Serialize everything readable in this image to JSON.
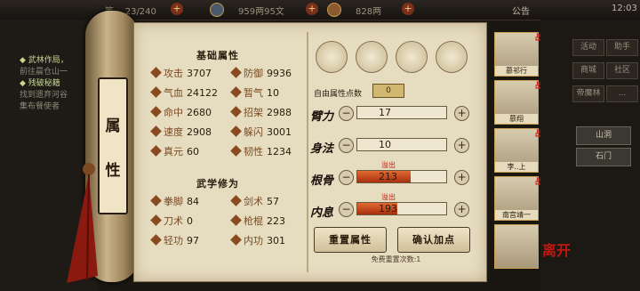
{
  "topbar": {
    "left_value": "等... 23/240",
    "silver": "959两95文",
    "gold": "828两",
    "notice": "公告",
    "time": "12:03"
  },
  "quests": [
    {
      "text": "◆ 武林作局，",
      "color": "#c8d890"
    },
    {
      "text": "前往晨仓山一",
      "color": "#8a8a78"
    },
    {
      "text": "◆ 残破秘籍",
      "color": "#c8d890"
    },
    {
      "text": "找到遗弃河谷",
      "color": "#8a8a78"
    },
    {
      "text": "集布餐使者",
      "color": "#8a8a78"
    }
  ],
  "scroll_label": [
    "属",
    "性"
  ],
  "base_title": "基础属性",
  "base_stats": [
    [
      {
        "label": "攻击",
        "value": "3707"
      },
      {
        "label": "防御",
        "value": "9936"
      }
    ],
    [
      {
        "label": "气血",
        "value": "24122"
      },
      {
        "label": "暂气",
        "value": "10"
      }
    ],
    [
      {
        "label": "命中",
        "value": "2680"
      },
      {
        "label": "招架",
        "value": "2988"
      }
    ],
    [
      {
        "label": "速度",
        "value": "2908"
      },
      {
        "label": "躲闪",
        "value": "3001"
      }
    ],
    [
      {
        "label": "真元",
        "value": "60"
      },
      {
        "label": "韧性",
        "value": "1234"
      }
    ]
  ],
  "martial_title": "武学修为",
  "martial_stats": [
    [
      {
        "label": "拳脚",
        "value": "84"
      },
      {
        "label": "剑术",
        "value": "57"
      }
    ],
    [
      {
        "label": "刀术",
        "value": "0"
      },
      {
        "label": "枪棍",
        "value": "223"
      }
    ],
    [
      {
        "label": "轻功",
        "value": "97"
      },
      {
        "label": "内功",
        "value": "301"
      }
    ]
  ],
  "free_points_label": "自由属性点数",
  "free_points_value": "0",
  "attributes": [
    {
      "char": "臂力",
      "value": "17",
      "overflow": "",
      "fill": 0.0
    },
    {
      "char": "身法",
      "value": "10",
      "overflow": "",
      "fill": 0.0
    },
    {
      "char": "根骨",
      "value": "213",
      "overflow": "溢出",
      "fill": 0.6
    },
    {
      "char": "内息",
      "value": "193",
      "overflow": "溢出",
      "fill": 0.45
    }
  ],
  "reset_button": "重置属性",
  "confirm_button": "确认加点",
  "free_reset": "免费重置次数:1",
  "portraits": [
    "慕祁行",
    "慕翔",
    "李..上",
    "南宫靖一",
    ""
  ],
  "side_buttons": [
    [
      "活动",
      "助手"
    ],
    [
      "商城",
      "社区"
    ],
    [
      "帝魔林",
      "..."
    ]
  ],
  "loc_buttons": [
    "山洞",
    "石门"
  ],
  "corner_label": "离开",
  "colors": {
    "accent": "#a83010",
    "paper": "#e6dcc0"
  }
}
